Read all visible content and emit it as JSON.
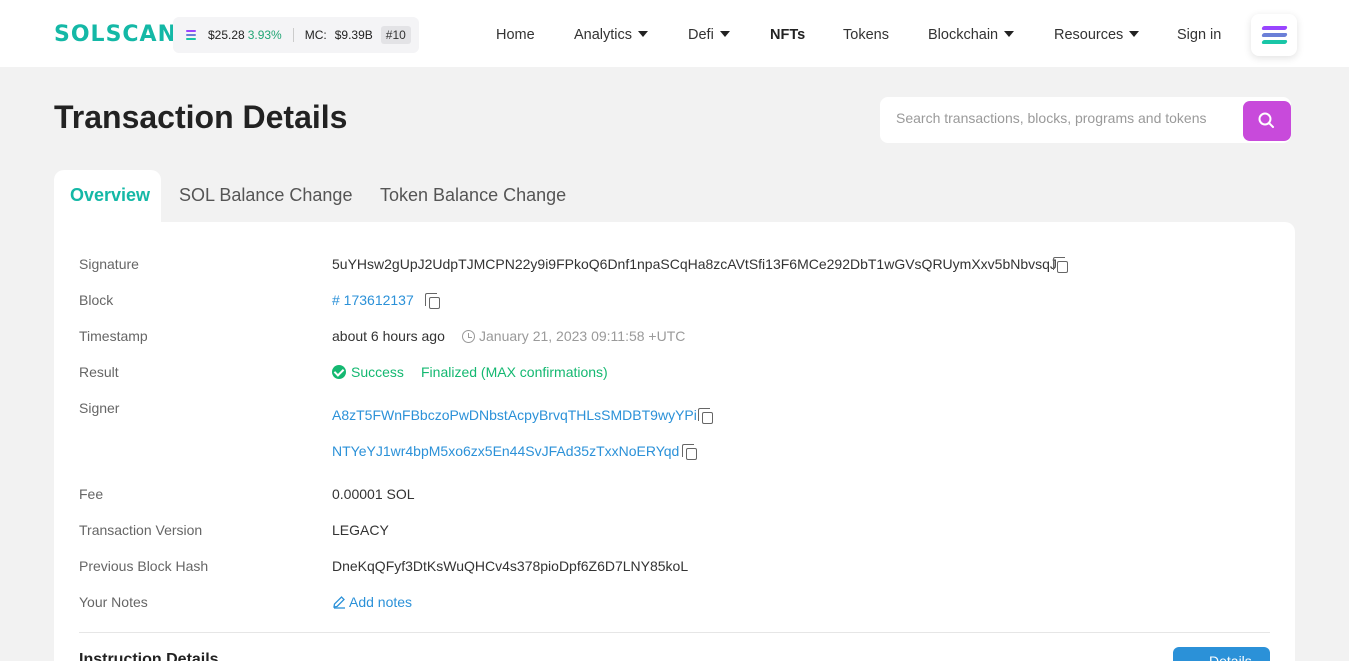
{
  "header": {
    "logo": "SOLSCAN",
    "price": "$25.28",
    "price_change": "3.93%",
    "mc_label": "MC:",
    "mc_value": "$9.39B",
    "rank": "#10",
    "nav": [
      {
        "label": "Home"
      },
      {
        "label": "Analytics"
      },
      {
        "label": "Defi"
      },
      {
        "label": "NFTs"
      },
      {
        "label": "Tokens"
      },
      {
        "label": "Blockchain"
      },
      {
        "label": "Resources"
      },
      {
        "label": "Sign in"
      }
    ]
  },
  "page": {
    "title": "Transaction Details",
    "search_placeholder": "Search transactions, blocks, programs and tokens"
  },
  "tabs": [
    {
      "label": "Overview",
      "active": true
    },
    {
      "label": "SOL Balance Change"
    },
    {
      "label": "Token Balance Change"
    }
  ],
  "overview": {
    "signature_label": "Signature",
    "signature": "5uYHsw2gUpJ2UdpTJMCPN22y9i9FPkoQ6Dnf1npaSCqHa8zcAVtSfi13F6MCe292DbT1wGVsQRUymXxv5bNbvsqJ",
    "block_label": "Block",
    "block": "# 173612137",
    "timestamp_label": "Timestamp",
    "timestamp_relative": "about 6 hours ago",
    "timestamp_absolute": "January 21, 2023 09:11:58 +UTC",
    "result_label": "Result",
    "result_status": "Success",
    "result_confirmation": "Finalized (MAX confirmations)",
    "signer_label": "Signer",
    "signers": [
      "A8zT5FWnFBbczoPwDNbstAcpyBrvqTHLsSMDBT9wyYPi",
      "NTYeYJ1wr4bpM5xo6zx5En44SvJFAd35zTxxNoERYqd"
    ],
    "fee_label": "Fee",
    "fee": "0.00001 SOL",
    "version_label": "Transaction Version",
    "version": "LEGACY",
    "prev_hash_label": "Previous Block Hash",
    "prev_hash": "DneKqQFyf3DtKsWuQHCv4s378pioDpf6Z6D7LNY85koL",
    "notes_label": "Your Notes",
    "notes_action": "Add notes"
  },
  "instructions": {
    "title": "Instruction Details",
    "details_button": "Details"
  },
  "colors": {
    "accent": "#14b8a6",
    "search_button": "#c84adb",
    "link": "#2b91d8",
    "success": "#14b871"
  }
}
